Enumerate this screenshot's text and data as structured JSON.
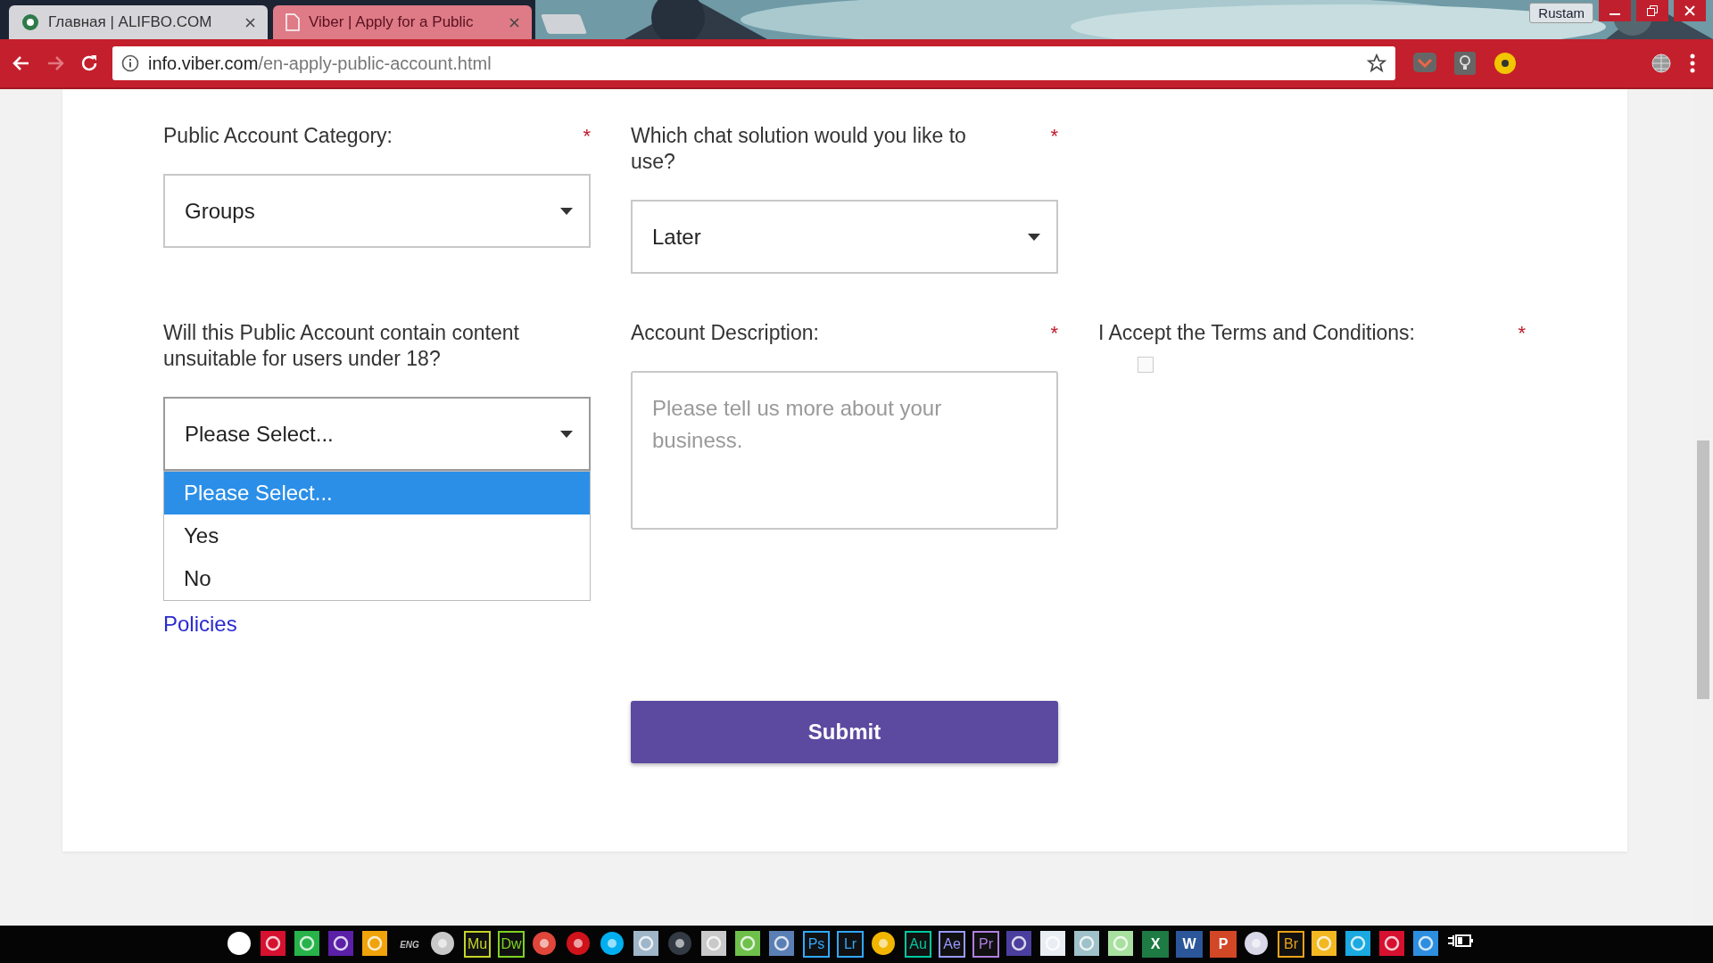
{
  "browser": {
    "tabs": [
      {
        "title": "Главная | ALIFBO.COM",
        "selected": false
      },
      {
        "title": "Viber | Apply for a Public",
        "selected": true
      }
    ],
    "profile": "Rustam",
    "address": {
      "host": "info.viber.com",
      "path": "/en-apply-public-account.html"
    }
  },
  "form": {
    "rows": [
      [
        {
          "kind": "select",
          "label": "Public Account Category:",
          "mark": "*",
          "value": "Groups"
        },
        {
          "kind": "select",
          "label": "Which chat solution would you like to use?",
          "mark": "*",
          "value": "Later"
        }
      ],
      [
        {
          "kind": "select",
          "label": "Will this Public Account contain content unsuitable for users under 18?",
          "value": "Please Select...",
          "expanded": true,
          "options": [
            {
              "label": "Please Select...",
              "selected": true
            },
            {
              "label": "Yes",
              "selected": false
            },
            {
              "label": "No",
              "selected": false
            }
          ]
        },
        {
          "kind": "textarea",
          "label": "Account Description:",
          "mark": "*",
          "placeholder": "Please tell us more about your business."
        },
        {
          "kind": "checkbox",
          "label": "I Accept the Terms and Conditions:",
          "mark": "*",
          "checked": false
        }
      ]
    ],
    "link": "Policies",
    "submit": "Submit"
  },
  "taskbar": [
    {
      "kind": "round",
      "color": "#ffffff"
    },
    {
      "kind": "square",
      "color": "#d6102f"
    },
    {
      "kind": "square",
      "color": "#27b34a"
    },
    {
      "kind": "square",
      "color": "#5b1fa8"
    },
    {
      "kind": "square",
      "color": "#f0a30a"
    },
    {
      "kind": "text",
      "label": "ENG",
      "color": "#bbbbbb"
    },
    {
      "kind": "round",
      "color": "#c8c8c8"
    },
    {
      "kind": "letter",
      "label": "Mu",
      "color": "#c5d42a"
    },
    {
      "kind": "letter",
      "label": "Dw",
      "color": "#7ed321"
    },
    {
      "kind": "round",
      "color": "#e0463a"
    },
    {
      "kind": "round",
      "color": "#d0121b"
    },
    {
      "kind": "round",
      "color": "#00aff0"
    },
    {
      "kind": "square",
      "color": "#9fb6c9"
    },
    {
      "kind": "round",
      "color": "#333a44"
    },
    {
      "kind": "square",
      "color": "#c9c9c9"
    },
    {
      "kind": "square",
      "color": "#6ec04b"
    },
    {
      "kind": "square",
      "color": "#5a7fb5"
    },
    {
      "kind": "letter",
      "label": "Ps",
      "color": "#31a8ff"
    },
    {
      "kind": "letter",
      "label": "Lr",
      "color": "#31a8ff"
    },
    {
      "kind": "round",
      "color": "#f2b600"
    },
    {
      "kind": "letter",
      "label": "Au",
      "color": "#00c8a0"
    },
    {
      "kind": "letter",
      "label": "Ae",
      "color": "#9999ff"
    },
    {
      "kind": "letter",
      "label": "Pr",
      "color": "#b07fe0"
    },
    {
      "kind": "square",
      "color": "#4a3f9e"
    },
    {
      "kind": "square",
      "color": "#e8eef4"
    },
    {
      "kind": "square",
      "color": "#9fc1c9"
    },
    {
      "kind": "square",
      "color": "#a8e0a0"
    },
    {
      "kind": "solid",
      "label": "X",
      "color": "#1d7b43"
    },
    {
      "kind": "solid",
      "label": "W",
      "color": "#2b579a"
    },
    {
      "kind": "solid",
      "label": "P",
      "color": "#d24726"
    },
    {
      "kind": "round",
      "color": "#d8d8e8"
    },
    {
      "kind": "letter",
      "label": "Br",
      "color": "#e8a317"
    },
    {
      "kind": "square",
      "color": "#f3b722"
    },
    {
      "kind": "square",
      "color": "#1aa9e0"
    },
    {
      "kind": "square",
      "color": "#d6102f"
    },
    {
      "kind": "square",
      "color": "#2d8ee0"
    },
    {
      "kind": "battery",
      "color": "#ffffff"
    }
  ]
}
